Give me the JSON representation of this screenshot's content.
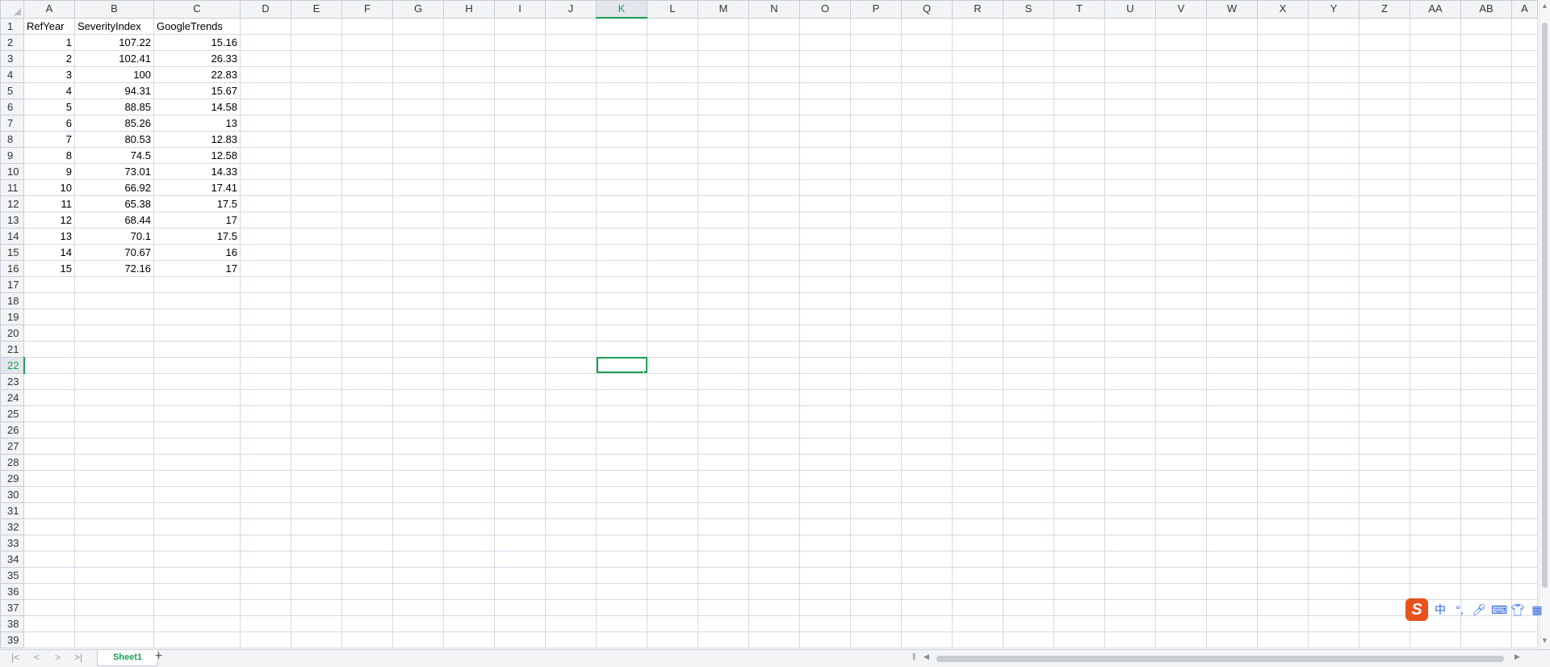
{
  "columns": [
    "A",
    "B",
    "C",
    "D",
    "E",
    "F",
    "G",
    "H",
    "I",
    "J",
    "K",
    "L",
    "M",
    "N",
    "O",
    "P",
    "Q",
    "R",
    "S",
    "T",
    "U",
    "V",
    "W",
    "X",
    "Y",
    "Z",
    "AA",
    "AB",
    "A"
  ],
  "row_numbers": [
    1,
    2,
    3,
    4,
    5,
    6,
    7,
    8,
    9,
    10,
    11,
    12,
    13,
    14,
    15,
    16,
    17,
    18,
    19,
    20,
    21,
    22,
    23,
    24,
    25,
    26,
    27,
    28,
    29,
    30,
    31,
    32,
    33,
    34,
    35,
    36,
    37,
    38,
    39
  ],
  "headers": [
    "RefYear",
    "SeverityIndex",
    "GoogleTrends"
  ],
  "rows": [
    [
      "1",
      "107.22",
      "15.16"
    ],
    [
      "2",
      "102.41",
      "26.33"
    ],
    [
      "3",
      "100",
      "22.83"
    ],
    [
      "4",
      "94.31",
      "15.67"
    ],
    [
      "5",
      "88.85",
      "14.58"
    ],
    [
      "6",
      "85.26",
      "13"
    ],
    [
      "7",
      "80.53",
      "12.83"
    ],
    [
      "8",
      "74.5",
      "12.58"
    ],
    [
      "9",
      "73.01",
      "14.33"
    ],
    [
      "10",
      "66.92",
      "17.41"
    ],
    [
      "11",
      "65.38",
      "17.5"
    ],
    [
      "12",
      "68.44",
      "17"
    ],
    [
      "13",
      "70.1",
      "17.5"
    ],
    [
      "14",
      "70.67",
      "16"
    ],
    [
      "15",
      "72.16",
      "17"
    ]
  ],
  "selection": {
    "column": "K",
    "row": 22
  },
  "sheet_tab": "Sheet1",
  "accent_color": "#1e9e54",
  "ime_toolbar": {
    "logo": "S",
    "mode": "中",
    "punct": "°,"
  }
}
